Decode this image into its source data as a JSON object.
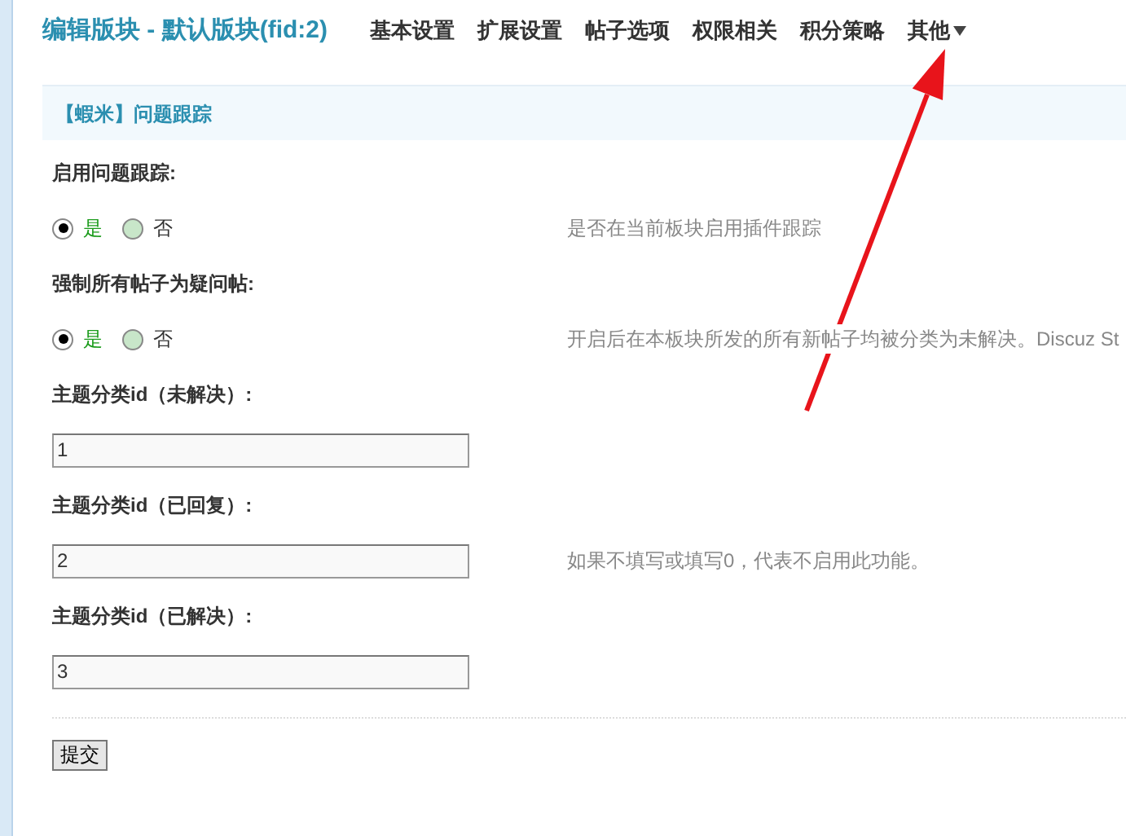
{
  "header": {
    "title": "编辑版块 - 默认版块(fid:2)",
    "nav": [
      {
        "label": "基本设置",
        "dropdown": false
      },
      {
        "label": "扩展设置",
        "dropdown": false
      },
      {
        "label": "帖子选项",
        "dropdown": false
      },
      {
        "label": "权限相关",
        "dropdown": false
      },
      {
        "label": "积分策略",
        "dropdown": false
      },
      {
        "label": "其他",
        "dropdown": true
      }
    ]
  },
  "section": {
    "title": "【蝦米】问题跟踪"
  },
  "settings": [
    {
      "kind": "radio",
      "label": "启用问题跟踪:",
      "options": [
        {
          "label": "是",
          "selected": true
        },
        {
          "label": "否",
          "selected": false
        }
      ],
      "description": "是否在当前板块启用插件跟踪"
    },
    {
      "kind": "radio",
      "label": "强制所有帖子为疑问帖:",
      "options": [
        {
          "label": "是",
          "selected": true
        },
        {
          "label": "否",
          "selected": false
        }
      ],
      "description": "开启后在本板块所发的所有新帖子均被分类为未解决。Discuz St"
    },
    {
      "kind": "text",
      "label": "主题分类id（未解决）:",
      "value": "1"
    },
    {
      "kind": "text",
      "label": "主题分类id（已回复）:",
      "value": "2",
      "description": "如果不填写或填写0，代表不启用此功能。"
    },
    {
      "kind": "text",
      "label": "主题分类id（已解决）:",
      "value": "3"
    }
  ],
  "submit": "提交"
}
